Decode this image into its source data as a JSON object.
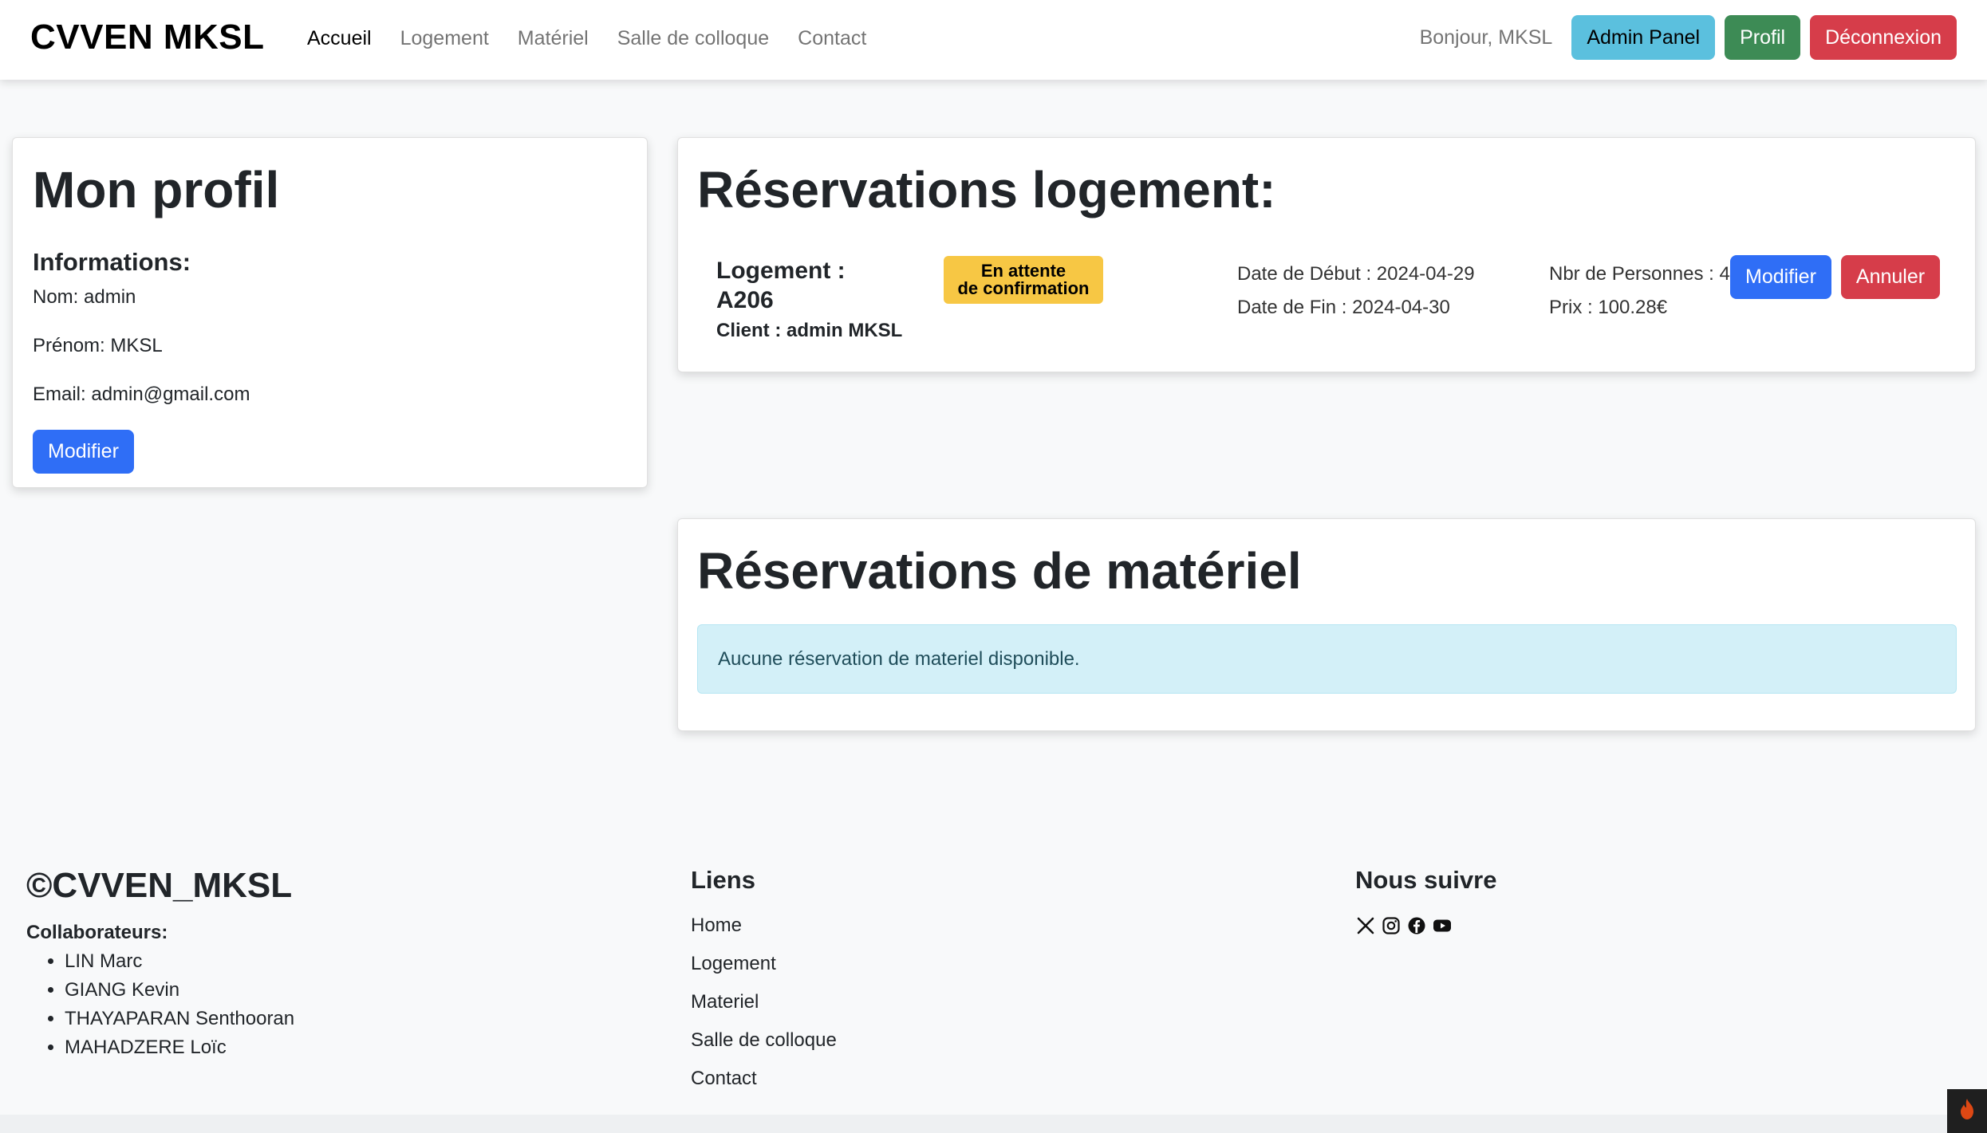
{
  "nav": {
    "brand": "CVVEN MKSL",
    "links": [
      "Accueil",
      "Logement",
      "Matériel",
      "Salle de colloque",
      "Contact"
    ],
    "greeting": "Bonjour, MKSL",
    "admin_label": "Admin Panel",
    "profile_label": "Profil",
    "logout_label": "Déconnexion"
  },
  "profile": {
    "title": "Mon profil",
    "subtitle": "Informations:",
    "nom": "Nom: admin",
    "prenom": "Prénom: MKSL",
    "email": "Email: admin@gmail.com",
    "edit_label": "Modifier"
  },
  "logement": {
    "title": "Réservations logement:",
    "reservation": {
      "name": "Logement : A206",
      "client": "Client : admin MKSL",
      "status_line1": "En attente",
      "status_line2": "de confirmation",
      "date_debut": "Date de Début : 2024-04-29",
      "date_fin": "Date de Fin : 2024-04-30",
      "personnes": "Nbr de Personnes : 4",
      "prix": "Prix : 100.28€",
      "edit_label": "Modifier",
      "cancel_label": "Annuler"
    }
  },
  "materiel": {
    "title": "Réservations de matériel",
    "empty_message": "Aucune réservation de materiel disponible."
  },
  "footer": {
    "brand": "©CVVEN_MKSL",
    "collab_title": "Collaborateurs:",
    "collaborators": [
      "LIN Marc",
      "GIANG Kevin",
      "THAYAPARAN Senthooran",
      "MAHADZERE Loïc"
    ],
    "links_title": "Liens",
    "links": [
      "Home",
      "Logement",
      "Materiel",
      "Salle de colloque",
      "Contact"
    ],
    "follow_title": "Nous suivre",
    "socials": [
      "x-icon",
      "instagram-icon",
      "facebook-icon",
      "youtube-icon"
    ]
  },
  "colors": {
    "info": "#5bc0de",
    "success": "#3d8b55",
    "danger": "#d63d4a",
    "primary": "#2f6ef6",
    "warning": "#f7c744",
    "alert_bg": "#d3f0f8"
  }
}
